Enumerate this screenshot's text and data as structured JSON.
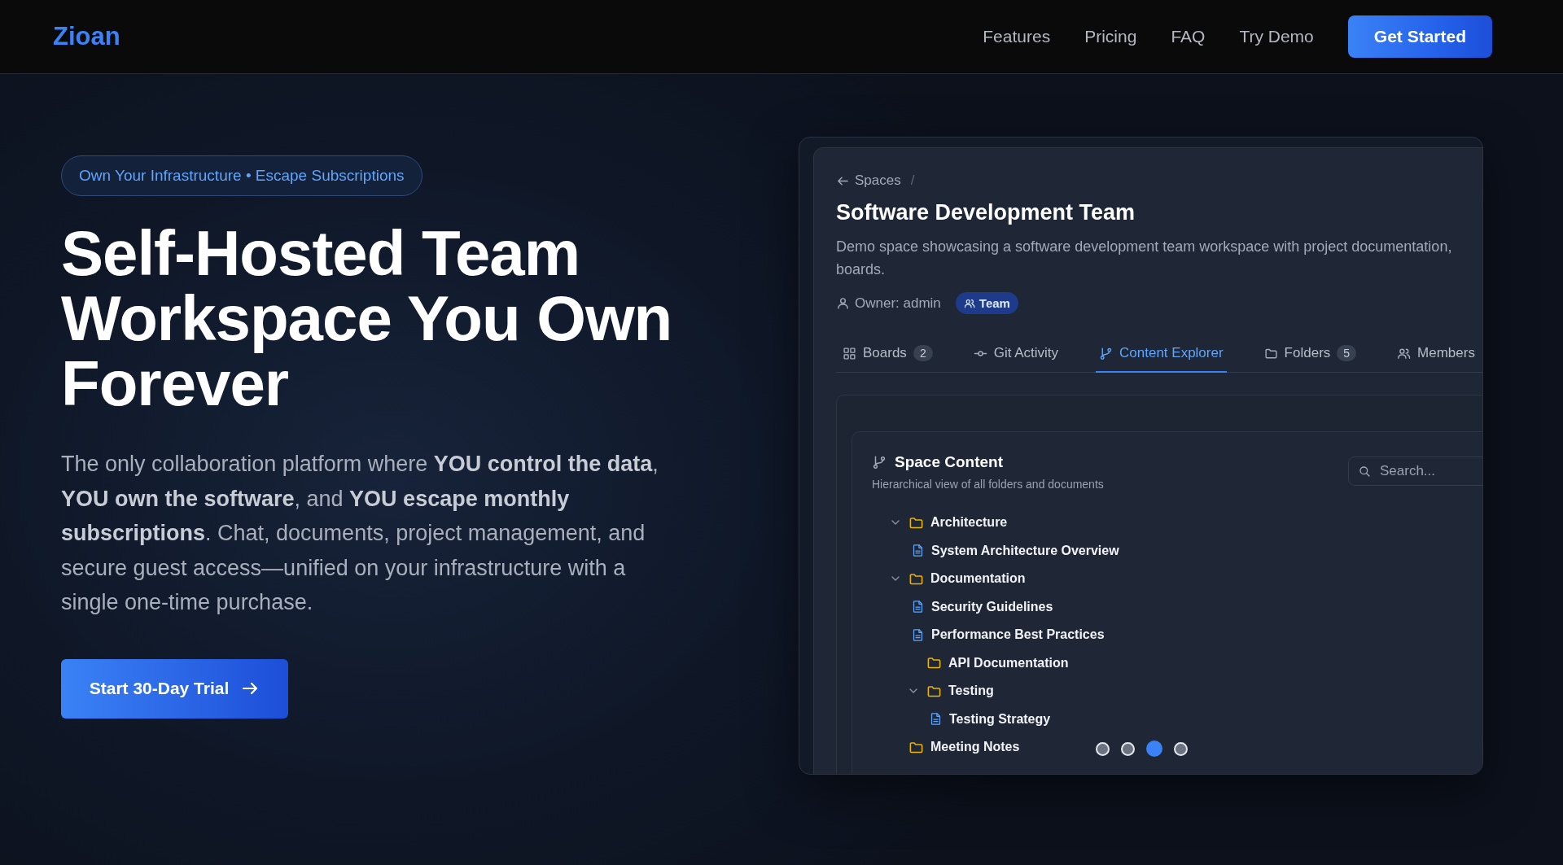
{
  "nav": {
    "logo": "Zioan",
    "links": [
      "Features",
      "Pricing",
      "FAQ",
      "Try Demo"
    ],
    "cta": "Get Started"
  },
  "hero": {
    "badge": "Own Your Infrastructure • Escape Subscriptions",
    "title": "Self-Hosted Team Workspace You Own Forever",
    "description": "The only collaboration platform where **YOU control the data**, **YOU own the software**, and **YOU escape monthly subscriptions**. Chat, documents, project management, and secure guest access—unified on your infrastructure with a single one-time purchase.",
    "cta": "Start 30-Day Trial"
  },
  "preview": {
    "breadcrumb": "Spaces",
    "separator": "/",
    "title": "Software Development Team",
    "description_lines": [
      "Demo space showcasing a software development team workspace with project documentation,",
      "boards."
    ],
    "owner": "Owner: admin",
    "tag": "Team",
    "tabs": [
      {
        "kind": "grid",
        "label": "Boards",
        "count": "2",
        "selected": false
      },
      {
        "kind": "commit",
        "label": "Git Activity",
        "selected": false
      },
      {
        "kind": "branch",
        "label": "Content Explorer",
        "selected": true
      },
      {
        "kind": "folder",
        "label": "Folders",
        "count": "5",
        "selected": false
      },
      {
        "kind": "users",
        "label": "Members",
        "selected": false
      }
    ],
    "content": {
      "title": "Space Content",
      "subtitle": "Hierarchical view of all folders and documents",
      "search_placeholder": "Search...",
      "tree": [
        {
          "kind": "folder",
          "label": "Architecture",
          "children": [
            {
              "kind": "document",
              "label": "System Architecture Overview"
            }
          ]
        },
        {
          "kind": "folder",
          "label": "Documentation",
          "children": [
            {
              "kind": "document",
              "label": "Security Guidelines"
            },
            {
              "kind": "document",
              "label": "Performance Best Practices"
            },
            {
              "kind": "folder",
              "label": "API Documentation"
            },
            {
              "kind": "folder",
              "label": "Testing",
              "children": [
                {
                  "kind": "document",
                  "label": "Testing Strategy"
                }
              ]
            }
          ]
        },
        {
          "kind": "folder",
          "label": "Meeting Notes"
        }
      ]
    },
    "dots": [
      {
        "selected": false
      },
      {
        "selected": false
      },
      {
        "selected": true
      },
      {
        "selected": false
      }
    ]
  }
}
